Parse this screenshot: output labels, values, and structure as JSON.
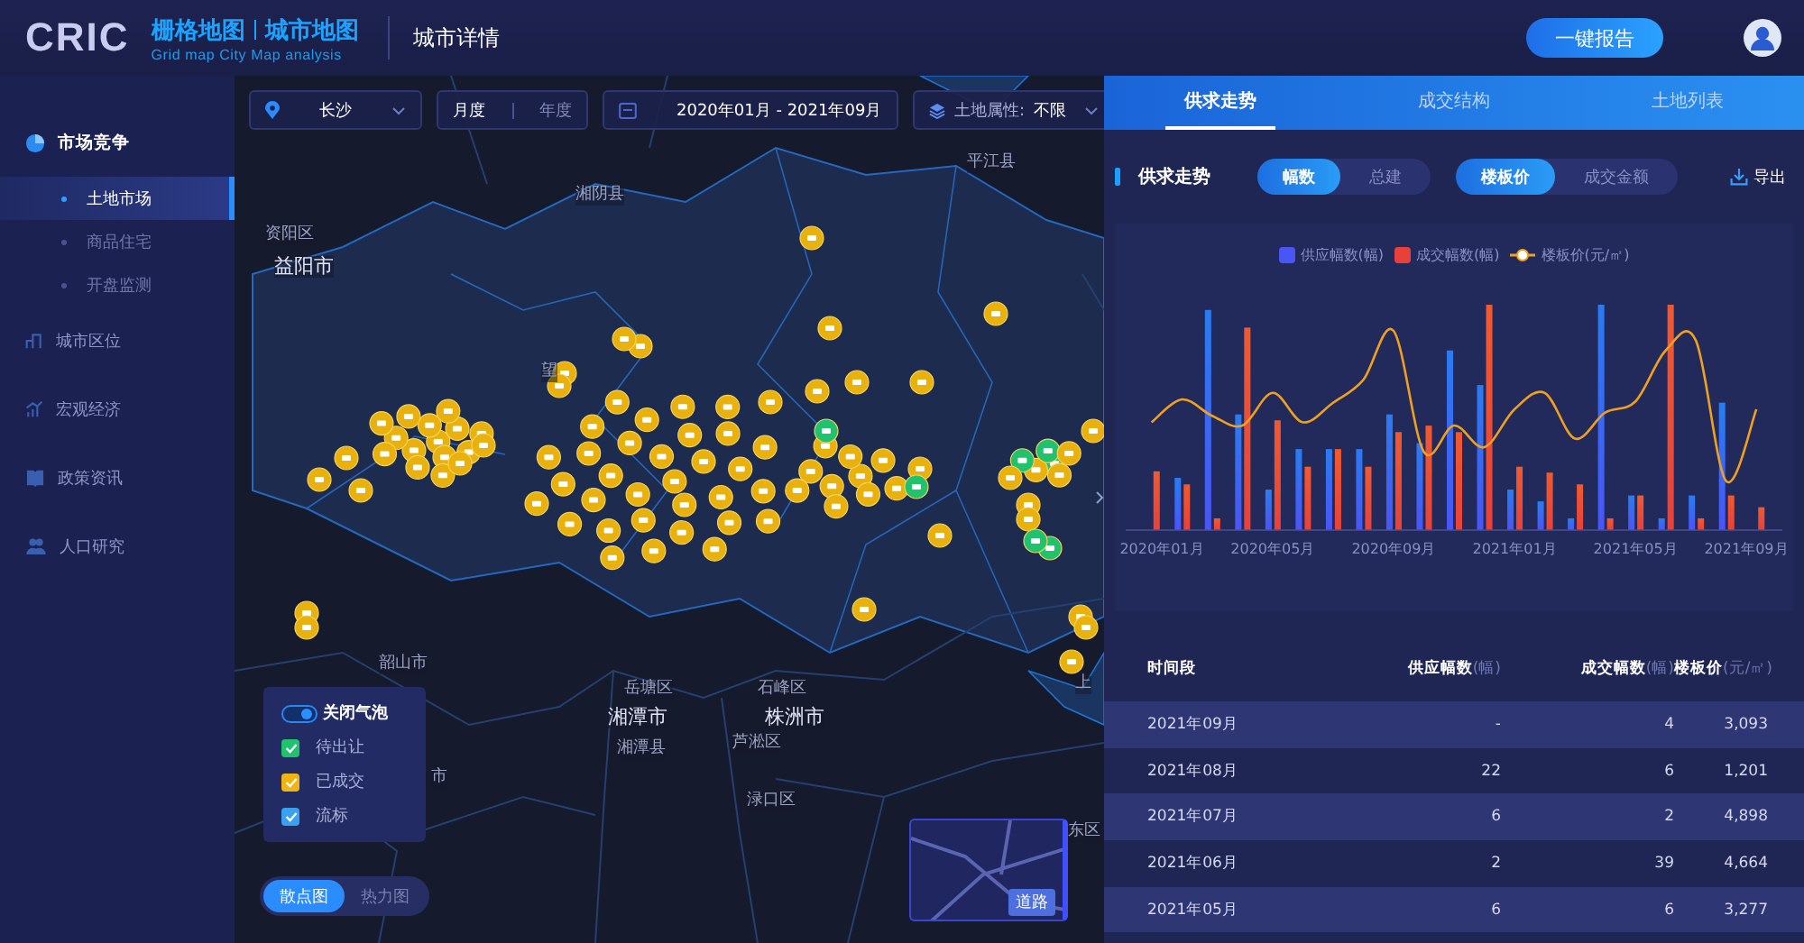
{
  "header": {
    "logo": "CRIC",
    "product_title_1": "栅格地图",
    "product_title_2": "城市地图",
    "product_subtitle": "Grid  map City Map analysis",
    "page_title": "城市详情",
    "report_button": "一键报告"
  },
  "sidebar": {
    "items": [
      {
        "label": "市场竞争",
        "children": [
          {
            "label": "土地市场",
            "selected": true
          },
          {
            "label": "商品住宅",
            "selected": false
          },
          {
            "label": "开盘监测",
            "selected": false
          }
        ]
      },
      {
        "label": "城市区位"
      },
      {
        "label": "宏观经济"
      },
      {
        "label": "政策资讯"
      },
      {
        "label": "人口研究"
      }
    ]
  },
  "filters": {
    "city": "长沙",
    "periods": [
      {
        "label": "月度",
        "selected": true
      },
      {
        "label": "年度",
        "selected": false
      }
    ],
    "date_range": "2020年01月 - 2021年09月",
    "land_attribute_label": "土地属性:",
    "land_attribute_value": "不限"
  },
  "map": {
    "labels": [
      {
        "text": "湘阴县",
        "kind": "town"
      },
      {
        "text": "平江县",
        "kind": "town"
      },
      {
        "text": "资阳区",
        "kind": "town"
      },
      {
        "text": "益阳市",
        "kind": "city"
      },
      {
        "text": "望",
        "kind": "town"
      },
      {
        "text": "韶山市",
        "kind": "town"
      },
      {
        "text": "岳塘区",
        "kind": "town"
      },
      {
        "text": "石峰区",
        "kind": "town"
      },
      {
        "text": "湘潭市",
        "kind": "city"
      },
      {
        "text": "株洲市",
        "kind": "city"
      },
      {
        "text": "湘潭县",
        "kind": "town"
      },
      {
        "text": "芦淞区",
        "kind": "town"
      },
      {
        "text": "渌口区",
        "kind": "town"
      },
      {
        "text": "市",
        "kind": "town"
      },
      {
        "text": "东区",
        "kind": "town"
      },
      {
        "text": "上",
        "kind": "town"
      }
    ],
    "bubble_toggle": {
      "label": "关闭气泡",
      "on": true
    },
    "statuses": [
      {
        "label": "待出让",
        "checked": true,
        "color": "#21c26e"
      },
      {
        "label": "已成交",
        "checked": true,
        "color": "#f0b414"
      },
      {
        "label": "流标",
        "checked": true,
        "color": "#3aa0f0"
      }
    ],
    "view_modes": [
      {
        "label": "散点图",
        "selected": true
      },
      {
        "label": "热力图",
        "selected": false
      }
    ],
    "minimap_label": "道路"
  },
  "panel": {
    "tabs": [
      {
        "label": "供求走势",
        "selected": true
      },
      {
        "label": "成交结构",
        "selected": false
      },
      {
        "label": "土地列表",
        "selected": false
      }
    ],
    "section_title": "供求走势",
    "toggle_groups": [
      [
        {
          "label": "幅数",
          "selected": true
        },
        {
          "label": "总建",
          "selected": false
        }
      ],
      [
        {
          "label": "楼板价",
          "selected": true
        },
        {
          "label": "成交金额",
          "selected": false
        }
      ]
    ],
    "export_label": "导出",
    "chart": {
      "legend": [
        {
          "label": "供应幅数(幅)",
          "color": "#4a55f5"
        },
        {
          "label": "成交幅数(幅)",
          "color": "#e8413a"
        },
        {
          "label": "楼板价(元/㎡)",
          "color": "#f0a020"
        }
      ],
      "x_labels": [
        "2020年01月",
        "2020年05月",
        "2020年09月",
        "2021年01月",
        "2021年05月",
        "2021年09月"
      ]
    },
    "table": {
      "columns": [
        {
          "label": "时间段"
        },
        {
          "label": "供应幅数",
          "unit": "(幅)"
        },
        {
          "label": "成交幅数",
          "unit": "(幅)"
        },
        {
          "label": "楼板价",
          "unit": "(元/㎡)"
        }
      ],
      "rows": [
        [
          "2021年09月",
          "-",
          "4",
          "3,093"
        ],
        [
          "2021年08月",
          "22",
          "6",
          "1,201"
        ],
        [
          "2021年07月",
          "6",
          "2",
          "4,898"
        ],
        [
          "2021年06月",
          "2",
          "39",
          "4,664"
        ],
        [
          "2021年05月",
          "6",
          "6",
          "3,277"
        ]
      ]
    }
  }
}
